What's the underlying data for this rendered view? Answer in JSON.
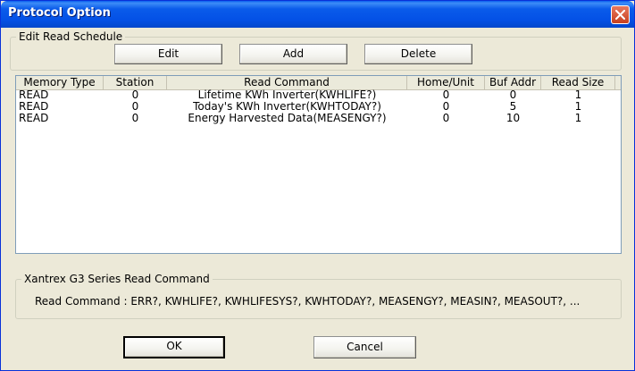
{
  "window": {
    "title": "Protocol Option"
  },
  "edit_group": {
    "legend": "Edit Read Schedule",
    "edit_label": "Edit",
    "add_label": "Add",
    "delete_label": "Delete"
  },
  "table": {
    "headers": [
      "Memory Type",
      "Station",
      "Read Command",
      "Home/Unit",
      "Buf Addr",
      "Read Size"
    ],
    "rows": [
      [
        "READ",
        "0",
        "Lifetime KWh Inverter(KWHLIFE?)",
        "0",
        "0",
        "1"
      ],
      [
        "READ",
        "0",
        "Today's KWh Inverter(KWHTODAY?)",
        "0",
        "5",
        "1"
      ],
      [
        "READ",
        "0",
        "Energy Harvested Data(MEASENGY?)",
        "0",
        "10",
        "1"
      ]
    ]
  },
  "info_group": {
    "legend": "Xantrex G3 Series Read Command",
    "text": "Read Command : ERR?, KWHLIFE?, KWHLIFESYS?, KWHTODAY?, MEASENGY?, MEASIN?, MEASOUT?, ..."
  },
  "footer": {
    "ok_label": "OK",
    "cancel_label": "Cancel"
  },
  "colors": {
    "titlebar": "#0451E6",
    "dialog_bg": "#ECE9D8",
    "close_button": "#C7401F"
  }
}
